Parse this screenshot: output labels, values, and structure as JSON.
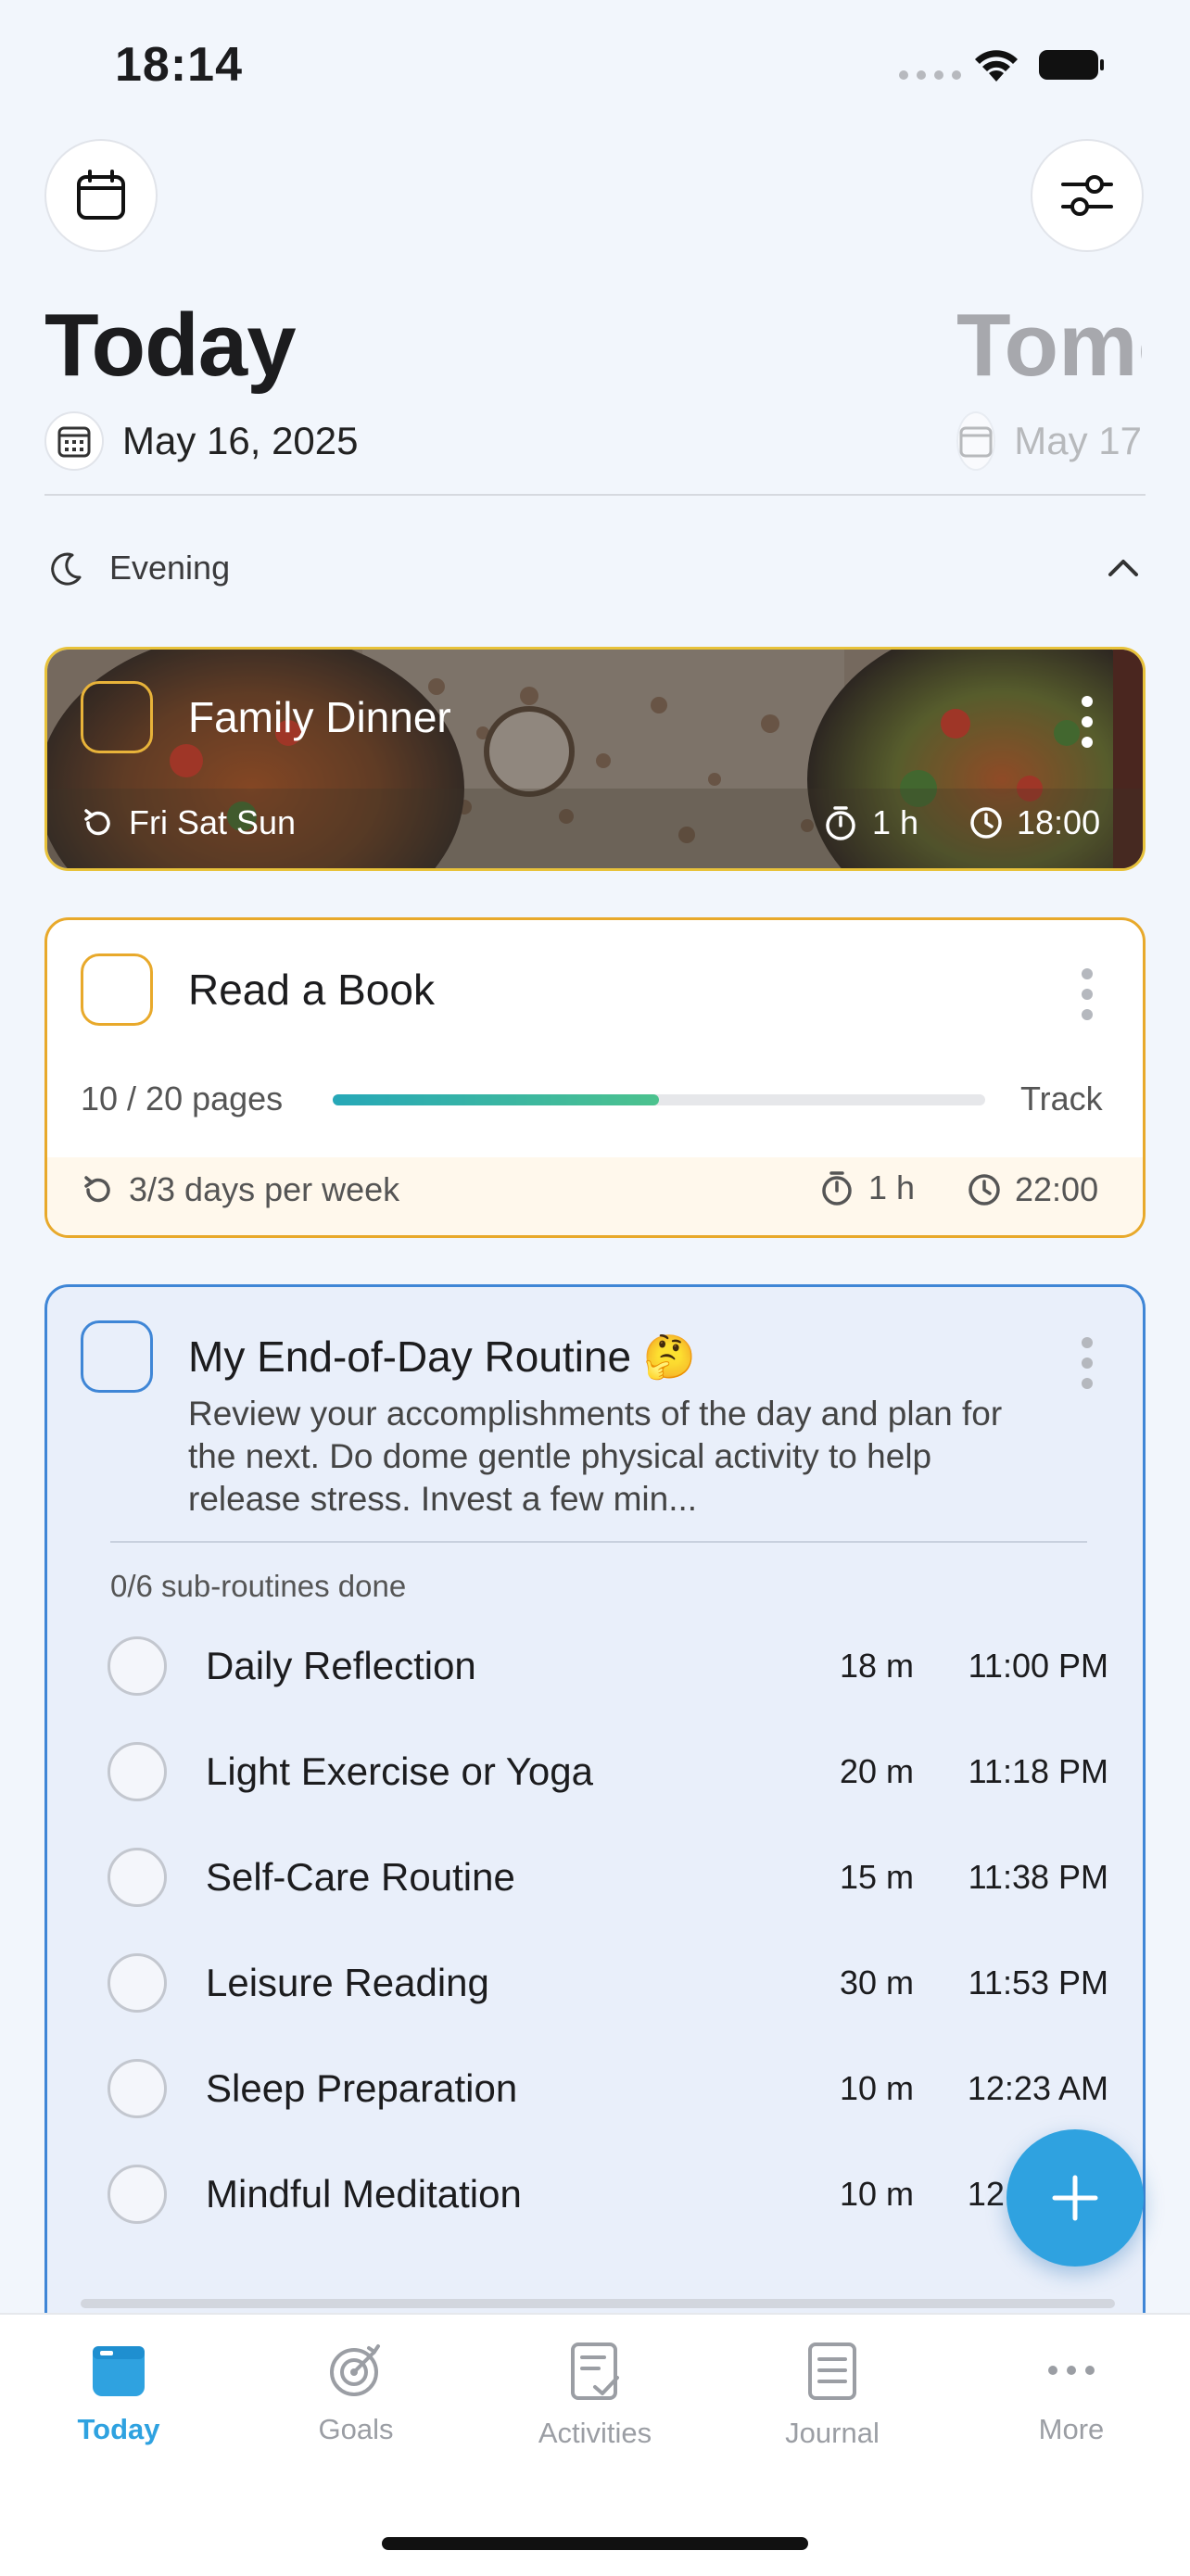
{
  "status_bar": {
    "time": "18:14"
  },
  "header": {
    "title": "Today",
    "next_title": "Tomorrow",
    "date": "May 16, 2025",
    "next_date": "May 17"
  },
  "section": {
    "label": "Evening"
  },
  "family_dinner": {
    "title": "Family Dinner",
    "repeat": "Fri Sat Sun",
    "duration": "1 h",
    "time": "18:00"
  },
  "read_book": {
    "title": "Read a Book",
    "progress_text": "10 / 20 pages",
    "progress_fraction": 0.5,
    "track_label": "Track",
    "repeat": "3/3 days per week",
    "duration": "1 h",
    "time": "22:00"
  },
  "routine": {
    "title": "My End-of-Day Routine 🤔",
    "description": "Review your accomplishments of the day and plan for the next. Do dome gentle physical activity to help release stress. Invest a few min...",
    "progress": "0/6 sub-routines done",
    "items": [
      {
        "name": "Daily Reflection",
        "duration": "18 m",
        "time": "11:00 PM"
      },
      {
        "name": "Light Exercise or Yoga",
        "duration": "20 m",
        "time": "11:18 PM"
      },
      {
        "name": "Self-Care Routine",
        "duration": "15 m",
        "time": "11:38 PM"
      },
      {
        "name": "Leisure Reading",
        "duration": "30 m",
        "time": "11:53 PM"
      },
      {
        "name": "Sleep Preparation",
        "duration": "10 m",
        "time": "12:23 AM"
      },
      {
        "name": "Mindful Meditation",
        "duration": "10 m",
        "time": "12:33 AM"
      }
    ]
  },
  "tabs": [
    {
      "label": "Today",
      "icon": "today-icon",
      "active": true
    },
    {
      "label": "Goals",
      "icon": "target-icon",
      "active": false
    },
    {
      "label": "Activities",
      "icon": "activities-icon",
      "active": false
    },
    {
      "label": "Journal",
      "icon": "journal-icon",
      "active": false
    },
    {
      "label": "More",
      "icon": "more-icon",
      "active": false
    }
  ],
  "colors": {
    "background": "#F2F6FC",
    "accent": "#2fa2e0",
    "habit_border": "#E8A92B",
    "routine_border": "#3F86D6",
    "progress": "#2BAEB0"
  }
}
